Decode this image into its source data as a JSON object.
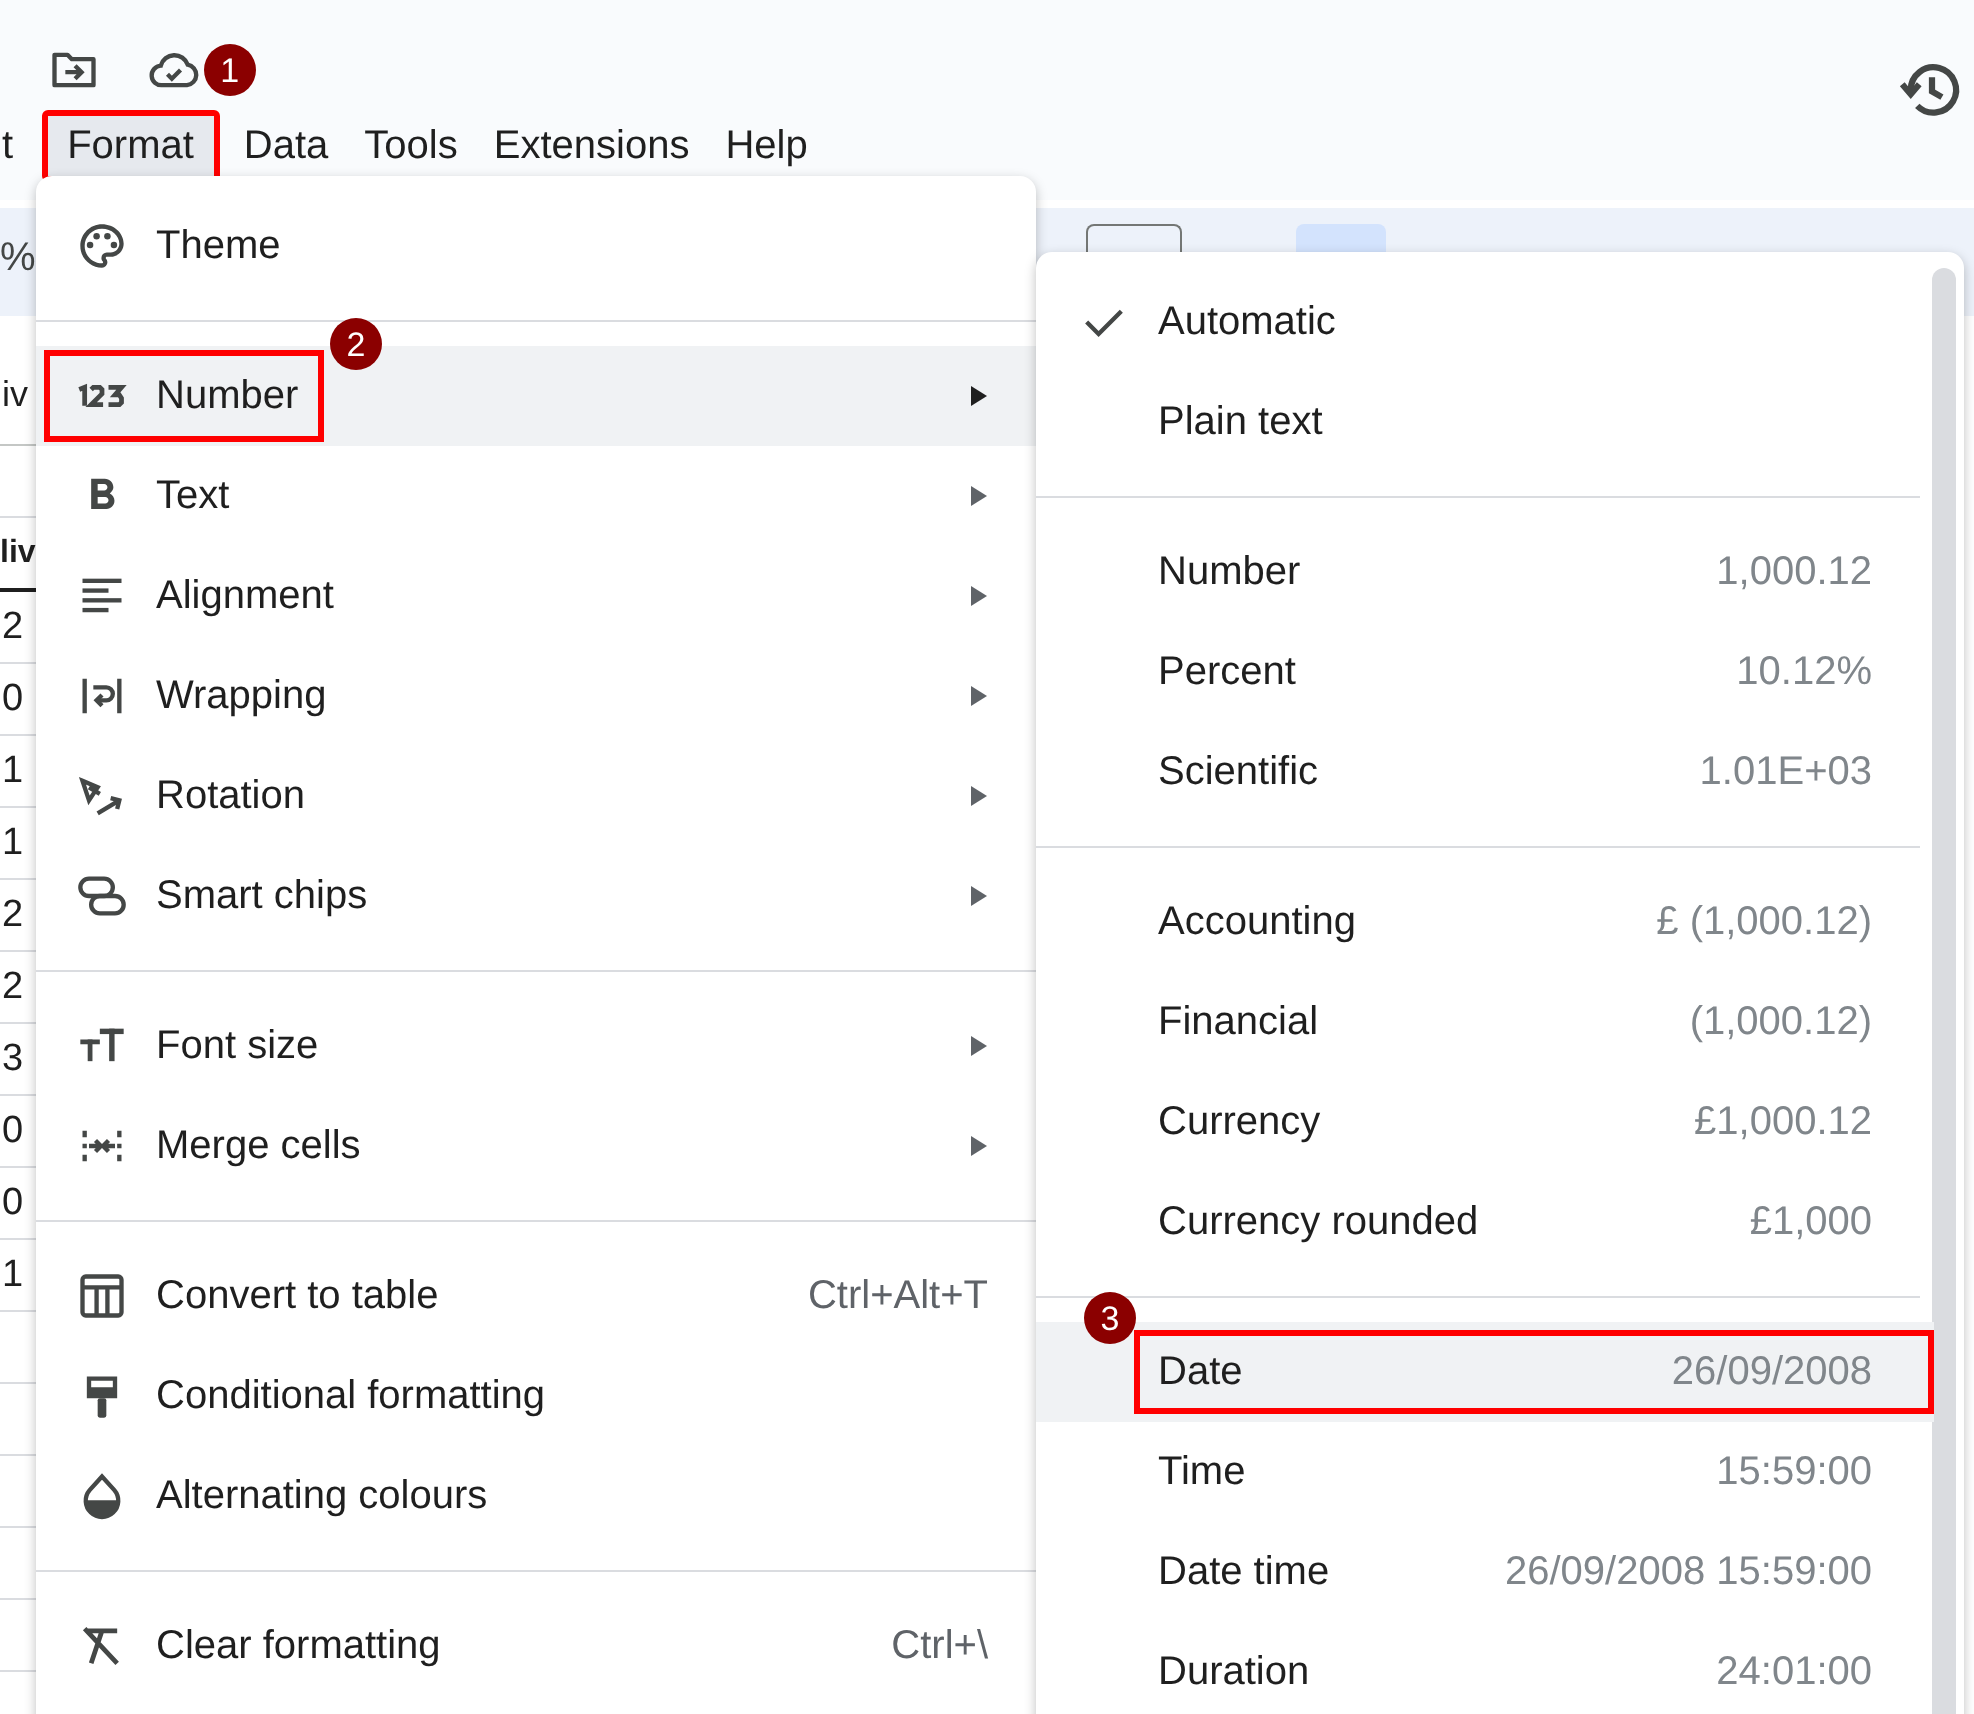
{
  "menu_bar": [
    {
      "label": "t",
      "selected": false
    },
    {
      "label": "Format",
      "selected": true,
      "badge": "1"
    },
    {
      "label": "Data",
      "selected": false
    },
    {
      "label": "Tools",
      "selected": false
    },
    {
      "label": "Extensions",
      "selected": false
    },
    {
      "label": "Help",
      "selected": false
    }
  ],
  "sheet": {
    "toolbar_text": "%",
    "name_box": "iv",
    "column_header": "liv",
    "cells": [
      "2",
      "0",
      "1",
      "1",
      "2",
      "2",
      "3",
      "0",
      "0",
      "1"
    ]
  },
  "format_menu": {
    "groups": [
      [
        {
          "label": "Theme",
          "selected": false,
          "submenu": false
        }
      ],
      [
        {
          "label": "Number",
          "selected": true,
          "submenu": true,
          "badge": "2"
        },
        {
          "label": "Text",
          "selected": false,
          "submenu": true
        },
        {
          "label": "Alignment",
          "selected": false,
          "submenu": true
        },
        {
          "label": "Wrapping",
          "selected": false,
          "submenu": true
        },
        {
          "label": "Rotation",
          "selected": false,
          "submenu": true
        },
        {
          "label": "Smart chips",
          "selected": false,
          "submenu": true
        }
      ],
      [
        {
          "label": "Font size",
          "selected": false,
          "submenu": true
        },
        {
          "label": "Merge cells",
          "selected": false,
          "submenu": true
        }
      ],
      [
        {
          "label": "Convert to table",
          "selected": false,
          "submenu": false,
          "shortcut": "Ctrl+Alt+T"
        },
        {
          "label": "Conditional formatting",
          "selected": false,
          "submenu": false
        },
        {
          "label": "Alternating colours",
          "selected": false,
          "submenu": false
        }
      ],
      [
        {
          "label": "Clear formatting",
          "selected": false,
          "submenu": false,
          "shortcut": "Ctrl+\\"
        }
      ]
    ]
  },
  "number_submenu": {
    "groups": [
      [
        {
          "label": "Automatic",
          "checked": true,
          "selected": false
        },
        {
          "label": "Plain text",
          "checked": false,
          "selected": false
        }
      ],
      [
        {
          "label": "Number",
          "example": "1,000.12",
          "checked": false,
          "selected": false
        },
        {
          "label": "Percent",
          "example": "10.12%",
          "checked": false,
          "selected": false
        },
        {
          "label": "Scientific",
          "example": "1.01E+03",
          "checked": false,
          "selected": false
        }
      ],
      [
        {
          "label": "Accounting",
          "example": "£ (1,000.12)",
          "checked": false,
          "selected": false
        },
        {
          "label": "Financial",
          "example": "(1,000.12)",
          "checked": false,
          "selected": false
        },
        {
          "label": "Currency",
          "example": "£1,000.12",
          "checked": false,
          "selected": false
        },
        {
          "label": "Currency rounded",
          "example": "£1,000",
          "checked": false,
          "selected": false
        }
      ],
      [
        {
          "label": "Date",
          "example": "26/09/2008",
          "checked": false,
          "selected": true,
          "badge": "3"
        },
        {
          "label": "Time",
          "example": "15:59:00",
          "checked": false,
          "selected": false
        },
        {
          "label": "Date time",
          "example": "26/09/2008 15:59:00",
          "checked": false,
          "selected": false
        },
        {
          "label": "Duration",
          "example": "24:01:00",
          "checked": false,
          "selected": false
        }
      ]
    ]
  }
}
